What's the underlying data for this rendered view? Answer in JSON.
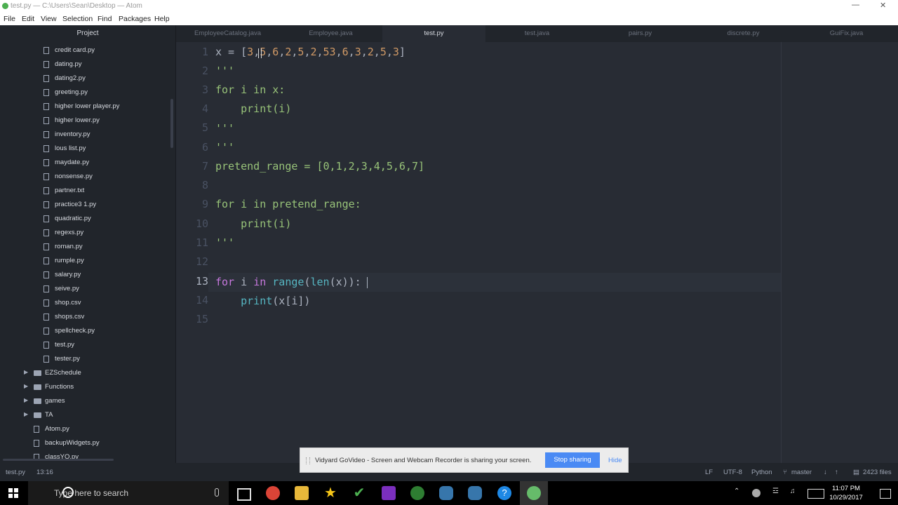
{
  "window": {
    "title": "test.py — C:\\Users\\Sean\\Desktop — Atom",
    "minimize": "—",
    "restore": "❐",
    "close": "✕"
  },
  "menu": [
    "File",
    "Edit",
    "View",
    "Selection",
    "Find",
    "Packages",
    "Help"
  ],
  "sidebar": {
    "header": "Project",
    "files": [
      "credit card.py",
      "dating.py",
      "dating2.py",
      "greeting.py",
      "higher lower player.py",
      "higher lower.py",
      "inventory.py",
      "lous list.py",
      "maydate.py",
      "nonsense.py",
      "partner.txt",
      "practice3 1.py",
      "quadratic.py",
      "regexs.py",
      "roman.py",
      "rumple.py",
      "salary.py",
      "seive.py",
      "shop.csv",
      "shops.csv",
      "spellcheck.py",
      "test.py",
      "tester.py"
    ],
    "folders": [
      "EZSchedule",
      "Functions",
      "games",
      "TA"
    ],
    "root_files": [
      "Atom.py",
      "backupWidgets.py",
      "classYO.py"
    ]
  },
  "tabs": [
    {
      "label": "EmployeeCatalog.java",
      "active": false
    },
    {
      "label": "Employee.java",
      "active": false
    },
    {
      "label": "test.py",
      "active": true
    },
    {
      "label": "test.java",
      "active": false
    },
    {
      "label": "pairs.py",
      "active": false
    },
    {
      "label": "discrete.py",
      "active": false
    },
    {
      "label": "GuiFix.java",
      "active": false
    }
  ],
  "editor": {
    "line_numbers": [
      "1",
      "2",
      "3",
      "4",
      "5",
      "6",
      "7",
      "8",
      "9",
      "10",
      "11",
      "12",
      "13",
      "14",
      "15"
    ],
    "current_line": 13,
    "colors": {
      "keyword": "#c678dd",
      "number": "#d19a66",
      "string": "#98c379",
      "function": "#61afef",
      "builtin": "#56b6c2",
      "text": "#abb2bf"
    }
  },
  "status": {
    "file": "test.py",
    "cursor": "13:16",
    "line_ending": "LF",
    "encoding": "UTF-8",
    "grammar": "Python",
    "branch": "master",
    "files_count": "2423 files"
  },
  "notification": {
    "message": "Vidyard GoVideo - Screen and Webcam Recorder is sharing your screen.",
    "stop_label": "Stop sharing",
    "hide_label": "Hide"
  },
  "taskbar": {
    "search_placeholder": "Type here to search",
    "time": "11:07 PM",
    "date": "10/29/2017",
    "app_icons": [
      "chrome-icon",
      "file-explorer-icon",
      "star-app-icon",
      "check-app-icon",
      "onenote-icon",
      "tree-app-icon",
      "python-icon",
      "python-alt-icon",
      "help-icon",
      "atom-icon"
    ]
  }
}
